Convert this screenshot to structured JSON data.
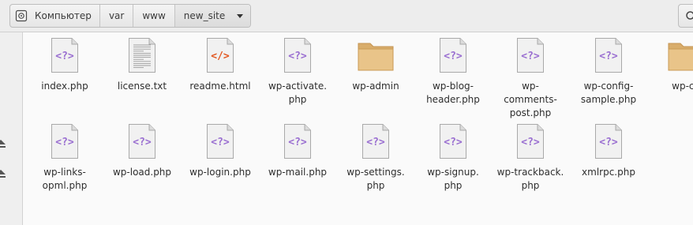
{
  "pathbar": {
    "home_label": "Компьютер",
    "segments": [
      "var",
      "www",
      "new_site"
    ]
  },
  "sidebar": {
    "devices": [
      "eject-icon",
      "eject-icon"
    ]
  },
  "colors": {
    "php_glyph": "#9a6fd1",
    "html_glyph": "#e25822",
    "folder": "#e9c489"
  },
  "files": [
    {
      "name": "index.php",
      "type": "php",
      "glyph": "<?>"
    },
    {
      "name": "license.txt",
      "type": "text"
    },
    {
      "name": "readme.html",
      "type": "html",
      "glyph": "</>"
    },
    {
      "name": "wp-activate.\nphp",
      "type": "php",
      "glyph": "<?>"
    },
    {
      "name": "wp-admin",
      "type": "folder"
    },
    {
      "name": "wp-blog-\nheader.php",
      "type": "php",
      "glyph": "<?>"
    },
    {
      "name": "wp-\ncomments-\npost.php",
      "type": "php",
      "glyph": "<?>"
    },
    {
      "name": "wp-config-\nsample.php",
      "type": "php",
      "glyph": "<?>"
    },
    {
      "name": "wp-co",
      "type": "folder"
    },
    {
      "name": "wp-links-\nopml.php",
      "type": "php",
      "glyph": "<?>"
    },
    {
      "name": "wp-load.php",
      "type": "php",
      "glyph": "<?>"
    },
    {
      "name": "wp-login.php",
      "type": "php",
      "glyph": "<?>"
    },
    {
      "name": "wp-mail.php",
      "type": "php",
      "glyph": "<?>"
    },
    {
      "name": "wp-settings.\nphp",
      "type": "php",
      "glyph": "<?>"
    },
    {
      "name": "wp-signup.\nphp",
      "type": "php",
      "glyph": "<?>"
    },
    {
      "name": "wp-trackback.\nphp",
      "type": "php",
      "glyph": "<?>"
    },
    {
      "name": "xmlrpc.php",
      "type": "php",
      "glyph": "<?>"
    }
  ]
}
